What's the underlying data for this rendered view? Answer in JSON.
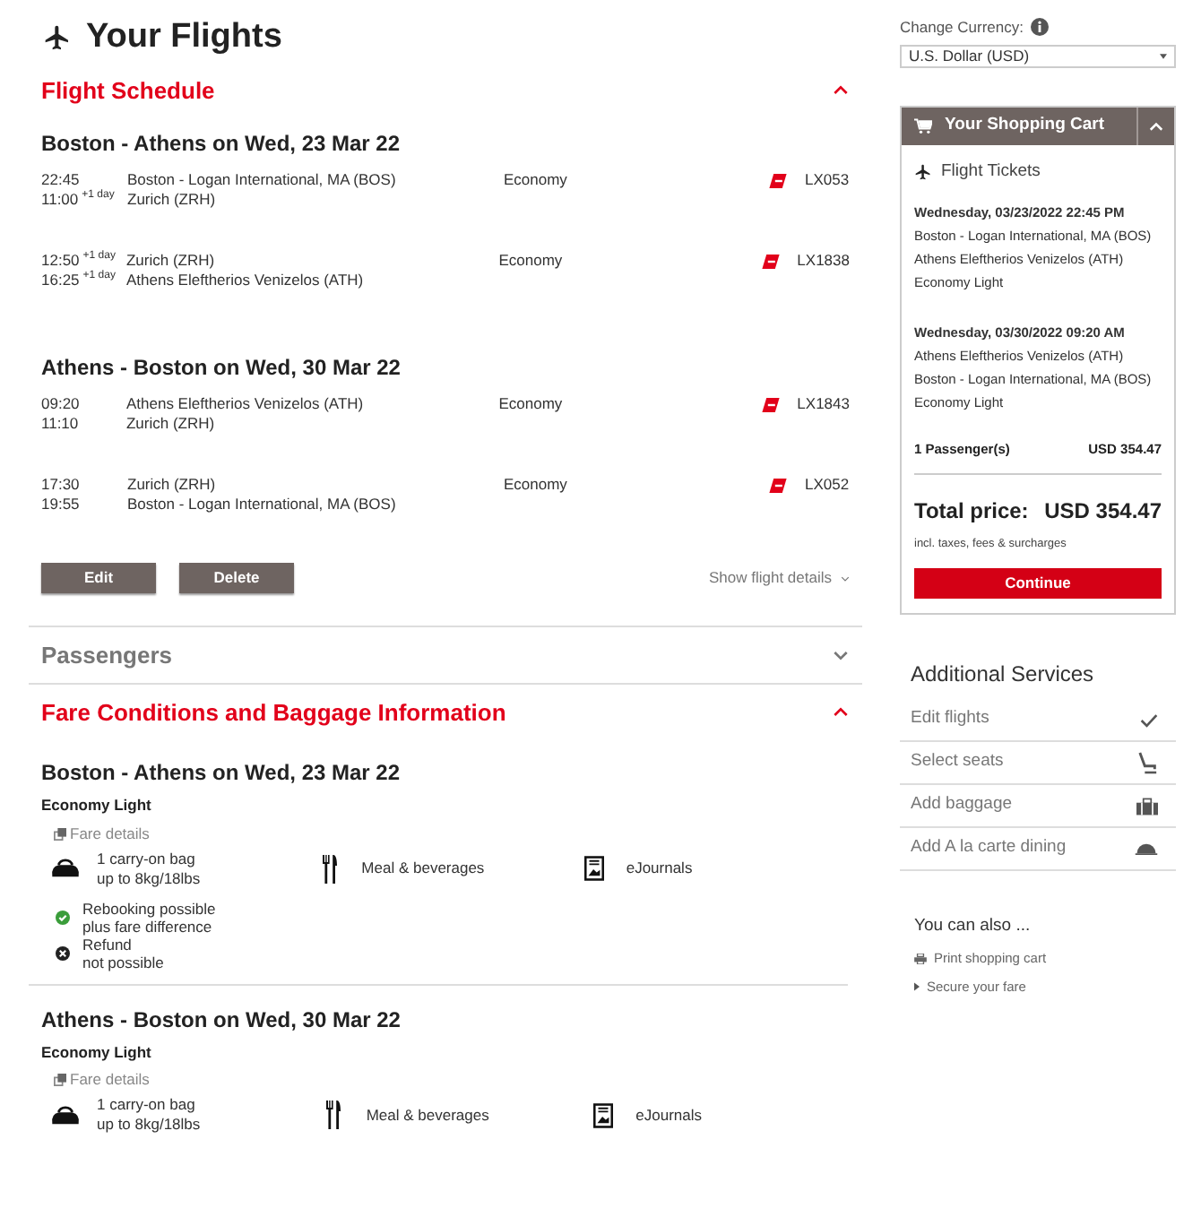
{
  "title": "Your Flights",
  "sections": [
    {
      "kind": "schedule",
      "title": "Flight Schedule",
      "expanded": true,
      "journeys": [
        {
          "heading": "Boston - Athens on Wed, 23 Mar 22",
          "segments": [
            {
              "dep_time": "22:45",
              "arr_time": "11:00",
              "arr_plus": "+1 day",
              "from": "Boston - Logan International, MA (BOS)",
              "to": "Zurich (ZRH)",
              "cabin": "Economy",
              "flight": "LX053"
            },
            {
              "dep_time": "12:50",
              "dep_plus": "+1 day",
              "arr_time": "16:25",
              "arr_plus": "+1 day",
              "from": "Zurich (ZRH)",
              "to": "Athens Eleftherios Venizelos (ATH)",
              "cabin": "Economy",
              "flight": "LX1838"
            }
          ]
        },
        {
          "heading": "Athens - Boston on Wed, 30 Mar 22",
          "segments": [
            {
              "dep_time": "09:20",
              "arr_time": "11:10",
              "from": "Athens Eleftherios Venizelos (ATH)",
              "to": "Zurich (ZRH)",
              "cabin": "Economy",
              "flight": "LX1843"
            },
            {
              "dep_time": "17:30",
              "arr_time": "19:55",
              "from": "Zurich (ZRH)",
              "to": "Boston - Logan International, MA (BOS)",
              "cabin": "Economy",
              "flight": "LX052"
            }
          ]
        }
      ],
      "buttons": [
        "Edit",
        "Delete"
      ],
      "details_link": "Show flight details"
    },
    {
      "kind": "passengers",
      "title": "Passengers",
      "expanded": false
    },
    {
      "kind": "fares",
      "title": "Fare Conditions and Baggage Information",
      "expanded": true,
      "journeys": [
        {
          "heading": "Boston - Athens on Wed, 23 Mar 22",
          "fare": "Economy Light",
          "details_link": "Fare details",
          "services": [
            {
              "kind": "bag",
              "lines": [
                "1 carry-on bag",
                "up to 8kg/18lbs"
              ]
            },
            {
              "kind": "meal",
              "lines": [
                "Meal & beverages"
              ]
            },
            {
              "kind": "journal",
              "lines": [
                "eJournals"
              ]
            }
          ],
          "conditions": [
            {
              "kind": "ok",
              "lines": [
                "Rebooking possible",
                "plus fare difference"
              ]
            },
            {
              "kind": "no",
              "lines": [
                "Refund",
                "not possible"
              ]
            }
          ]
        },
        {
          "heading": "Athens - Boston on Wed, 30 Mar 22",
          "fare": "Economy Light",
          "details_link": "Fare details",
          "services": [
            {
              "kind": "bag",
              "lines": [
                "1 carry-on bag",
                "up to 8kg/18lbs"
              ]
            },
            {
              "kind": "meal",
              "lines": [
                "Meal & beverages"
              ]
            },
            {
              "kind": "journal",
              "lines": [
                "eJournals"
              ]
            }
          ]
        }
      ]
    }
  ],
  "currency": {
    "label": "Change Currency:",
    "value": "U.S. Dollar (USD)"
  },
  "cart": {
    "title": "Your Shopping Cart",
    "expanded": true,
    "section": "Flight Tickets",
    "trips": [
      {
        "date": "Wednesday, 03/23/2022 22:45 PM",
        "lines": [
          "Boston - Logan International, MA (BOS)",
          "Athens Eleftherios Venizelos (ATH)",
          "Economy Light"
        ]
      },
      {
        "date": "Wednesday, 03/30/2022 09:20 AM",
        "lines": [
          "Athens Eleftherios Venizelos (ATH)",
          "Boston - Logan International, MA (BOS)",
          "Economy Light"
        ]
      }
    ],
    "passengers": "1 Passenger(s)",
    "passengers_price": "USD 354.47",
    "total_label": "Total price:",
    "total": "USD 354.47",
    "note": "incl. taxes, fees & surcharges",
    "button": "Continue"
  },
  "additional": {
    "title": "Additional Services",
    "items": [
      {
        "kind": "check",
        "label": "Edit flights"
      },
      {
        "kind": "seat",
        "label": "Select seats"
      },
      {
        "kind": "baggage",
        "label": "Add baggage"
      },
      {
        "kind": "dining",
        "label": "Add A la carte dining"
      }
    ]
  },
  "also": {
    "title": "You can also ...",
    "links": [
      {
        "kind": "print",
        "label": "Print shopping cart"
      },
      {
        "kind": "arrow",
        "label": "Secure your fare"
      }
    ]
  }
}
